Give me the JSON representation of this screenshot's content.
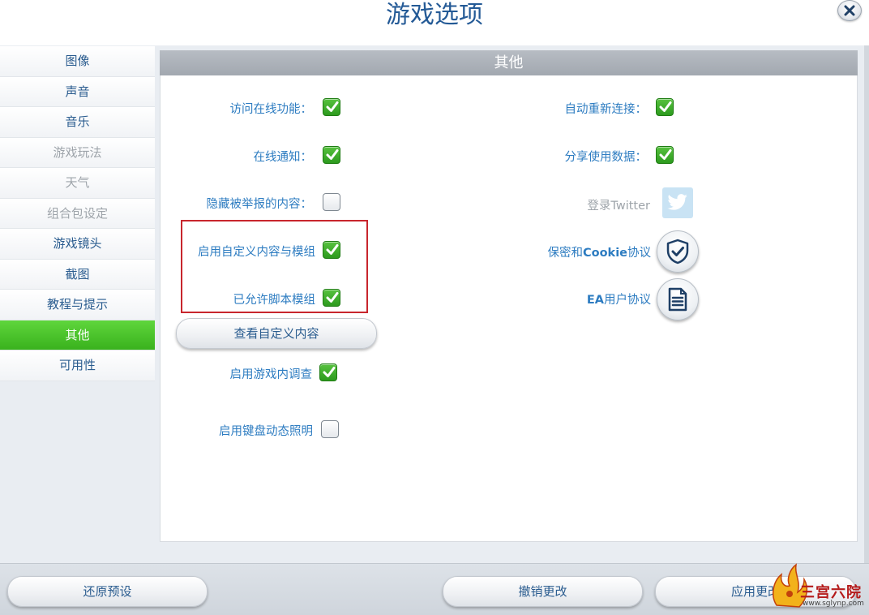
{
  "window": {
    "title": "游戏选项"
  },
  "sidebar": {
    "items": [
      {
        "label": "图像",
        "state": "normal"
      },
      {
        "label": "声音",
        "state": "normal"
      },
      {
        "label": "音乐",
        "state": "normal"
      },
      {
        "label": "游戏玩法",
        "state": "disabled"
      },
      {
        "label": "天气",
        "state": "disabled"
      },
      {
        "label": "组合包设定",
        "state": "disabled"
      },
      {
        "label": "游戏镜头",
        "state": "normal"
      },
      {
        "label": "截图",
        "state": "normal"
      },
      {
        "label": "教程与提示",
        "state": "normal"
      },
      {
        "label": "其他",
        "state": "active"
      },
      {
        "label": "可用性",
        "state": "normal"
      }
    ]
  },
  "panel": {
    "header": "其他",
    "left_options": [
      {
        "label": "访问在线功能：",
        "checked": true
      },
      {
        "label": "在线通知：",
        "checked": true
      },
      {
        "label": "隐藏被举报的内容：",
        "checked": false
      },
      {
        "label": "启用自定义内容与模组",
        "checked": true
      },
      {
        "label": "已允许脚本模组",
        "checked": true
      }
    ],
    "view_custom_content_button": "查看自定义内容",
    "lower_options": [
      {
        "label": "启用游戏内调查",
        "checked": true
      },
      {
        "label": "启用键盘动态照明",
        "checked": false
      }
    ],
    "right_options": [
      {
        "label": "自动重新连接：",
        "checked": true
      },
      {
        "label": "分享使用数据：",
        "checked": true
      }
    ],
    "twitter": {
      "label": "登录Twitter",
      "icon": "twitter-bird-icon",
      "color": "#c9e3f4"
    },
    "privacy": {
      "prefix": "保密和",
      "bold": "Cookie",
      "suffix": "协议",
      "icon": "shield-check-icon"
    },
    "ea_agreement": {
      "bold": "EA",
      "suffix": "用户协议",
      "icon": "document-icon"
    }
  },
  "footer": {
    "restore_defaults": "还原预设",
    "cancel_changes": "撤销更改",
    "apply_changes": "应用更改"
  },
  "watermark": {
    "text": "三宫六院",
    "url": "www.sglynp.com"
  },
  "colors": {
    "accent_green": "#39b21d",
    "text_blue": "#2d7cc1",
    "highlight_red": "#c8262d"
  }
}
